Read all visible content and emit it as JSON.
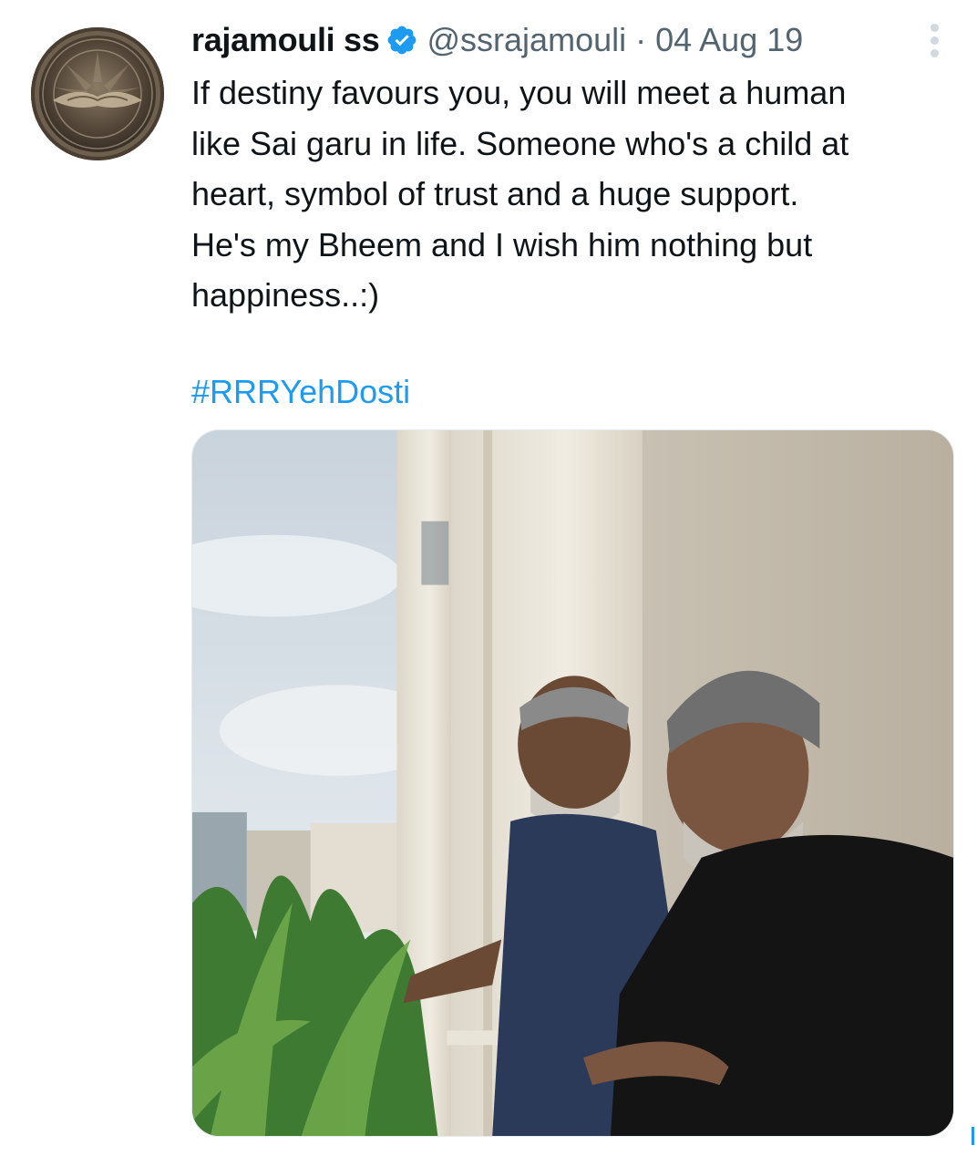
{
  "tweet": {
    "display_name": "rajamouli ss",
    "handle": "@ssrajamouli",
    "separator": "·",
    "date": "04 Aug 19",
    "verified": true,
    "body_lines": [
      "If destiny favours you, you will meet a human",
      "like Sai garu in life. Someone who's a child at",
      "heart, symbol of trust and a huge support.",
      "He's my Bheem and I wish him nothing but",
      "happiness..:)"
    ],
    "hashtag": "#RRRYehDosti"
  },
  "icons": {
    "verified": "verified-badge-icon",
    "more": "more-options-icon"
  },
  "colors": {
    "text": "#0f1419",
    "secondary": "#536471",
    "link": "#1d9bf0",
    "verified": "#1d9bf0"
  }
}
